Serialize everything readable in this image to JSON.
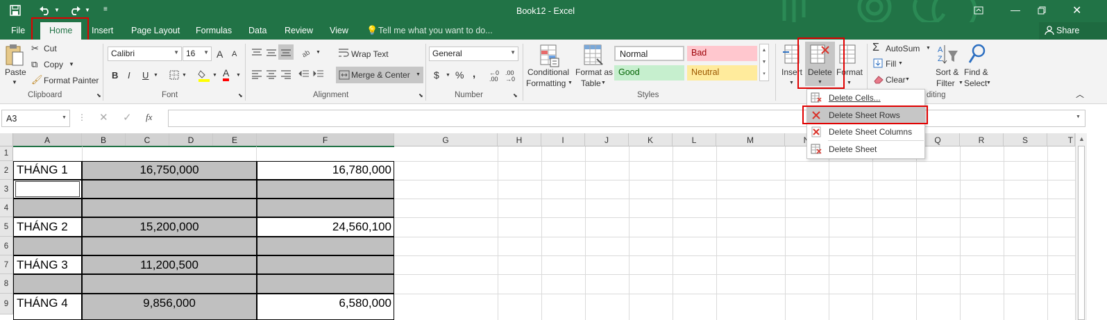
{
  "window": {
    "title": "Book12 - Excel"
  },
  "tabs": [
    {
      "label": "File"
    },
    {
      "label": "Home"
    },
    {
      "label": "Insert"
    },
    {
      "label": "Page Layout"
    },
    {
      "label": "Formulas"
    },
    {
      "label": "Data"
    },
    {
      "label": "Review"
    },
    {
      "label": "View"
    }
  ],
  "tell_me": "Tell me what you want to do...",
  "share": "Share",
  "clipboard": {
    "paste": "Paste",
    "cut": "Cut",
    "copy": "Copy",
    "format_painter": "Format Painter",
    "group": "Clipboard"
  },
  "font": {
    "name": "Calibri",
    "size": "16",
    "bold": "B",
    "italic": "I",
    "underline": "U",
    "font_color_letter": "A",
    "grow": "A",
    "shrink": "A",
    "group": "Font"
  },
  "alignment": {
    "wrap_text": "Wrap Text",
    "merge_center": "Merge & Center",
    "group": "Alignment"
  },
  "number": {
    "format": "General",
    "currency": "$",
    "percent": "%",
    "comma": ",",
    "group": "Number"
  },
  "styles": {
    "conditional_1": "Conditional",
    "conditional_2": "Formatting",
    "format_as_1": "Format as",
    "format_as_2": "Table",
    "normal": "Normal",
    "bad": "Bad",
    "good": "Good",
    "neutral": "Neutral",
    "group": "Styles"
  },
  "cells": {
    "insert": "Insert",
    "delete": "Delete",
    "format": "Format"
  },
  "editing": {
    "autosum": "AutoSum",
    "fill": "Fill",
    "clear": "Clear",
    "sort_1": "Sort &",
    "sort_2": "Filter",
    "find_1": "Find &",
    "find_2": "Select",
    "group_partial": "diting"
  },
  "delete_menu": [
    {
      "label": "Delete Cells..."
    },
    {
      "label": "Delete Sheet Rows"
    },
    {
      "label": "Delete Sheet Columns"
    },
    {
      "label": "Delete Sheet"
    }
  ],
  "name_box": "A3",
  "fx": "fx",
  "columns": [
    "A",
    "B",
    "C",
    "D",
    "E",
    "F",
    "G",
    "H",
    "I",
    "J",
    "K",
    "L",
    "M",
    "N",
    "O",
    "P",
    "Q",
    "R",
    "S",
    "T"
  ],
  "rows": [
    "1",
    "2",
    "3",
    "4",
    "5",
    "6",
    "7",
    "8",
    "9"
  ],
  "data": {
    "r2": {
      "a": "THÁNG 1",
      "bcde": "16,750,000",
      "f": "16,780,000"
    },
    "r5": {
      "a": "THÁNG 2",
      "bcde": "15,200,000",
      "f": "24,560,100"
    },
    "r7": {
      "a": "THÁNG 3",
      "bcde": "11,200,500",
      "f": ""
    },
    "r9": {
      "a": "THÁNG 4",
      "bcde": "9,856,000",
      "f": "6,580,000"
    }
  },
  "colors": {
    "excel_green": "#217346",
    "highlight_red": "#e00000",
    "gray_fill": "#c0c0c0"
  }
}
